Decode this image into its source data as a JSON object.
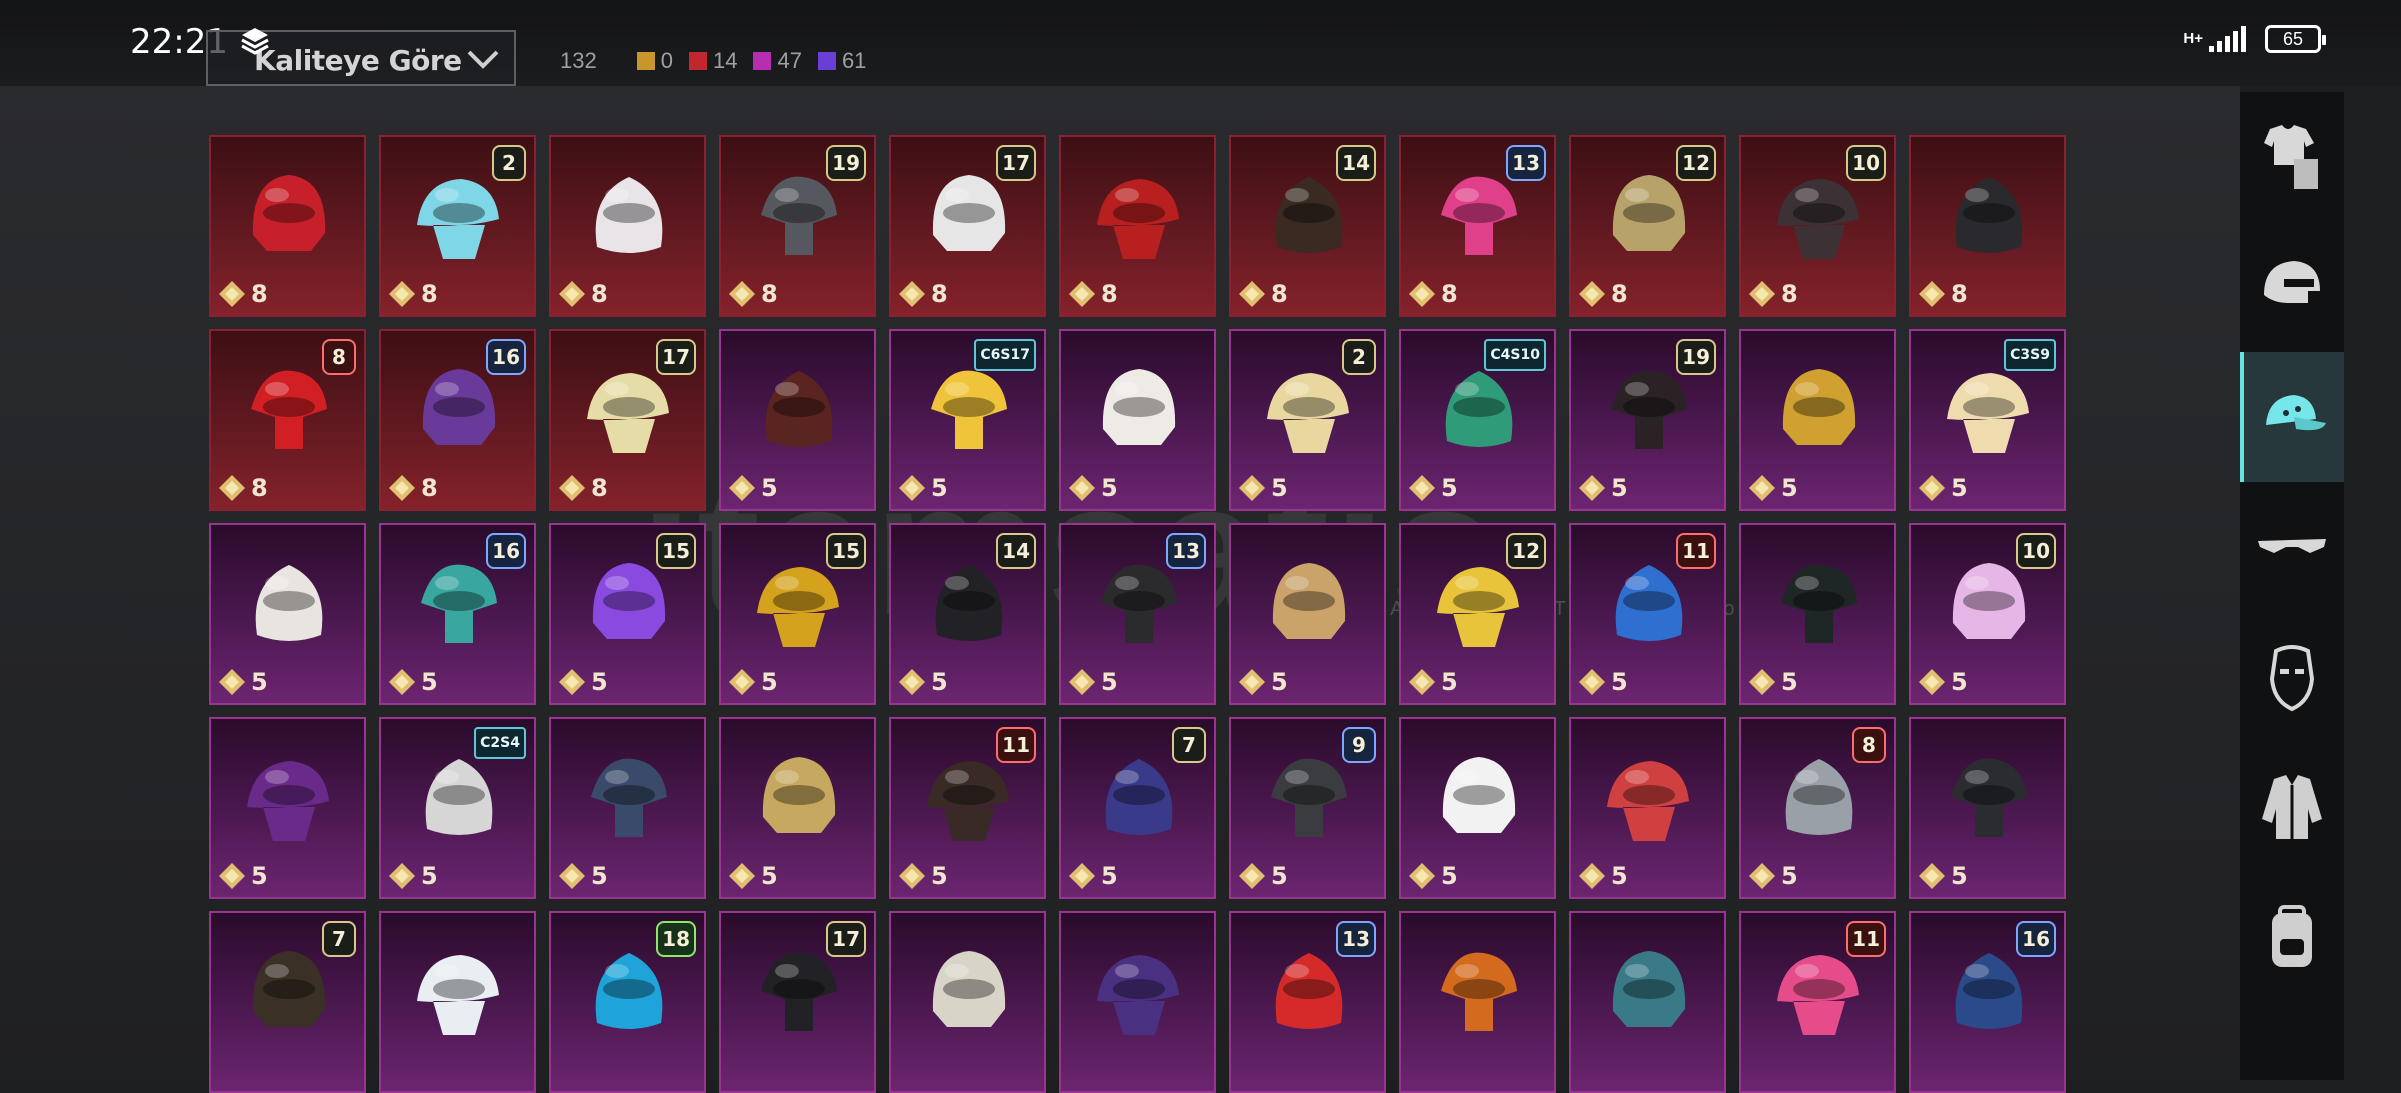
{
  "status_bar": {
    "time": "22:21",
    "network": "H+",
    "battery": "65"
  },
  "sort": {
    "label": "Kaliteye Göre"
  },
  "counts": {
    "total": "132",
    "items": [
      {
        "color": "#c8962a",
        "value": "0"
      },
      {
        "color": "#c0282e",
        "value": "14"
      },
      {
        "color": "#b52fb0",
        "value": "47"
      },
      {
        "color": "#6a3fd6",
        "value": "61"
      }
    ]
  },
  "watermark": {
    "text": "itemsatis",
    "sub": "HESAP / SATIŞ / İTEM / EŞYA .com"
  },
  "sidebar": {
    "items": [
      {
        "name": "outfit-category-icon"
      },
      {
        "name": "helmet-category-icon"
      },
      {
        "name": "headwear-category-icon",
        "active": true
      },
      {
        "name": "eyewear-category-icon"
      },
      {
        "name": "face-category-icon"
      },
      {
        "name": "jacket-category-icon"
      },
      {
        "name": "backpack-category-icon"
      }
    ]
  },
  "items": [
    {
      "rarity": "red",
      "price": "8",
      "badge": "",
      "tone": "#c8202a"
    },
    {
      "rarity": "red",
      "price": "8",
      "badge": "2",
      "tone": "#7fd6e6"
    },
    {
      "rarity": "red",
      "price": "8",
      "badge": "",
      "tone": "#e8e4e8"
    },
    {
      "rarity": "red",
      "price": "8",
      "badge": "19",
      "tone": "#55585e"
    },
    {
      "rarity": "red",
      "price": "8",
      "badge": "17",
      "tone": "#e6e6e6"
    },
    {
      "rarity": "red",
      "price": "8",
      "badge": "",
      "tone": "#b82020"
    },
    {
      "rarity": "red",
      "price": "8",
      "badge": "14",
      "tone": "#3a2a22"
    },
    {
      "rarity": "red",
      "price": "8",
      "badge": "13",
      "tone": "#e0408a"
    },
    {
      "rarity": "red",
      "price": "8",
      "badge": "12",
      "tone": "#b7a36a"
    },
    {
      "rarity": "red",
      "price": "8",
      "badge": "10",
      "tone": "#3c3236"
    },
    {
      "rarity": "red",
      "price": "8",
      "badge": "",
      "tone": "#2a2a2e"
    },
    {
      "rarity": "red",
      "price": "8",
      "badge": "8",
      "tone": "#d21f24"
    },
    {
      "rarity": "red",
      "price": "8",
      "badge": "16",
      "tone": "#6a3a9a"
    },
    {
      "rarity": "red",
      "price": "8",
      "badge": "17",
      "tone": "#e6dca8"
    },
    {
      "rarity": "purple",
      "price": "5",
      "badge": "",
      "tone": "#5a2420"
    },
    {
      "rarity": "purple",
      "price": "5",
      "badge": "C6S17",
      "tone": "#f0c43a"
    },
    {
      "rarity": "purple",
      "price": "5",
      "badge": "",
      "tone": "#eeeae6"
    },
    {
      "rarity": "purple",
      "price": "5",
      "badge": "2",
      "tone": "#e8d8a0"
    },
    {
      "rarity": "purple",
      "price": "5",
      "badge": "C4S10",
      "tone": "#2f9b78"
    },
    {
      "rarity": "purple",
      "price": "5",
      "badge": "19",
      "tone": "#2a2224"
    },
    {
      "rarity": "purple",
      "price": "5",
      "badge": "",
      "tone": "#d0a030"
    },
    {
      "rarity": "purple",
      "price": "5",
      "badge": "C3S9",
      "tone": "#efdcae"
    },
    {
      "rarity": "purple",
      "price": "5",
      "badge": "",
      "tone": "#e8e4e0"
    },
    {
      "rarity": "purple",
      "price": "5",
      "badge": "16",
      "tone": "#3aa6a0"
    },
    {
      "rarity": "purple",
      "price": "5",
      "badge": "15",
      "tone": "#8a4ae0"
    },
    {
      "rarity": "purple",
      "price": "5",
      "badge": "15",
      "tone": "#d4a21c"
    },
    {
      "rarity": "purple",
      "price": "5",
      "badge": "14",
      "tone": "#222226"
    },
    {
      "rarity": "purple",
      "price": "5",
      "badge": "13",
      "tone": "#2b2b2e"
    },
    {
      "rarity": "purple",
      "price": "5",
      "badge": "",
      "tone": "#c9a36a"
    },
    {
      "rarity": "purple",
      "price": "5",
      "badge": "12",
      "tone": "#e8c43a"
    },
    {
      "rarity": "purple",
      "price": "5",
      "badge": "11",
      "tone": "#2f6fd0"
    },
    {
      "rarity": "purple",
      "price": "5",
      "badge": "",
      "tone": "#1f2626"
    },
    {
      "rarity": "purple",
      "price": "5",
      "badge": "10",
      "tone": "#e6b6e6"
    },
    {
      "rarity": "purple",
      "price": "5",
      "badge": "",
      "tone": "#6a2a8a"
    },
    {
      "rarity": "purple",
      "price": "5",
      "badge": "C2S4",
      "tone": "#d6d6d6"
    },
    {
      "rarity": "purple",
      "price": "5",
      "badge": "",
      "tone": "#3a4a6a"
    },
    {
      "rarity": "purple",
      "price": "5",
      "badge": "",
      "tone": "#c6a860"
    },
    {
      "rarity": "purple",
      "price": "5",
      "badge": "11",
      "tone": "#3a2a26"
    },
    {
      "rarity": "purple",
      "price": "5",
      "badge": "7",
      "tone": "#3a3a8a"
    },
    {
      "rarity": "purple",
      "price": "5",
      "badge": "9",
      "tone": "#3a3c40"
    },
    {
      "rarity": "purple",
      "price": "5",
      "badge": "",
      "tone": "#f2f2f2"
    },
    {
      "rarity": "purple",
      "price": "5",
      "badge": "",
      "tone": "#d04040"
    },
    {
      "rarity": "purple",
      "price": "5",
      "badge": "8",
      "tone": "#9aa0a8"
    },
    {
      "rarity": "purple",
      "price": "5",
      "badge": "",
      "tone": "#2a2c30"
    },
    {
      "rarity": "purple",
      "price": "",
      "badge": "7",
      "tone": "#3a3026"
    },
    {
      "rarity": "purple",
      "price": "",
      "badge": "",
      "tone": "#e8eef2"
    },
    {
      "rarity": "purple",
      "price": "",
      "badge": "18",
      "tone": "#1ea4d8"
    },
    {
      "rarity": "purple",
      "price": "",
      "badge": "17",
      "tone": "#222226"
    },
    {
      "rarity": "purple",
      "price": "",
      "badge": "",
      "tone": "#d8d4c8"
    },
    {
      "rarity": "purple",
      "price": "",
      "badge": "",
      "tone": "#4a3080"
    },
    {
      "rarity": "purple",
      "price": "",
      "badge": "13",
      "tone": "#d42a2a"
    },
    {
      "rarity": "purple",
      "price": "",
      "badge": "",
      "tone": "#d46a1e"
    },
    {
      "rarity": "purple",
      "price": "",
      "badge": "",
      "tone": "#3a7a86"
    },
    {
      "rarity": "purple",
      "price": "",
      "badge": "11",
      "tone": "#e64c8a"
    },
    {
      "rarity": "purple",
      "price": "",
      "badge": "16",
      "tone": "#2a4a8a"
    }
  ]
}
